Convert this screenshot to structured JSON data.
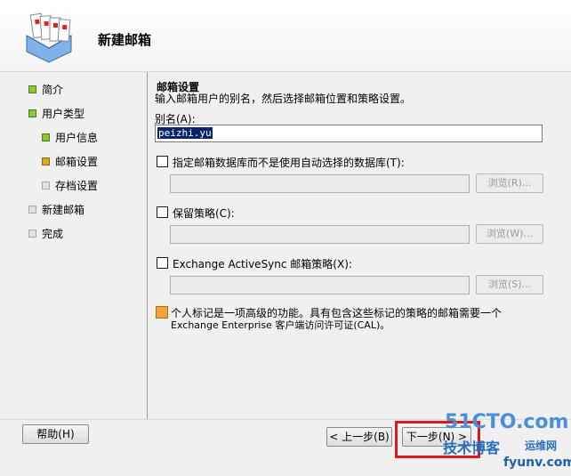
{
  "wizard": {
    "title": "新建邮箱"
  },
  "sidebar": {
    "items": [
      {
        "label": "简介",
        "state": "done"
      },
      {
        "label": "用户类型",
        "state": "done"
      },
      {
        "label": "用户信息",
        "state": "done"
      },
      {
        "label": "邮箱设置",
        "state": "current"
      },
      {
        "label": "存档设置",
        "state": "todo"
      },
      {
        "label": "新建邮箱",
        "state": "todo"
      },
      {
        "label": "完成",
        "state": "todo"
      }
    ]
  },
  "main": {
    "section_title": "邮箱设置",
    "description": "输入邮箱用户的别名，然后选择邮箱位置和策略设置。",
    "alias_label": "别名(A):",
    "alias_value": "peizhi.yu",
    "db_checkbox_label": "指定邮箱数据库而不是使用自动选择的数据库(T):",
    "retention_checkbox_label": "保留策略(C):",
    "activesync_checkbox_label": "Exchange ActiveSync 邮箱策略(X):",
    "browse_r": "浏览(R)...",
    "browse_w": "浏览(W)...",
    "browse_s": "浏览(S)...",
    "info_line1": "个人标记是一项高级的功能。具有包含这些标记的策略的邮箱需要一个",
    "info_line2": "Exchange Enterprise 客户端访问许可证(CAL)。"
  },
  "footer": {
    "help": "帮助(H)",
    "back": "< 上一步(B)",
    "next": "下一步(N) >"
  },
  "watermark": {
    "line1": "51CTO.com",
    "line2": "技术博客",
    "line3": "fyunv.com",
    "line4": "运维网"
  },
  "colors": {
    "done": "#8fc43a",
    "current": "#d8a824",
    "todo": "#e0e0e0",
    "highlight": "#e01818"
  }
}
